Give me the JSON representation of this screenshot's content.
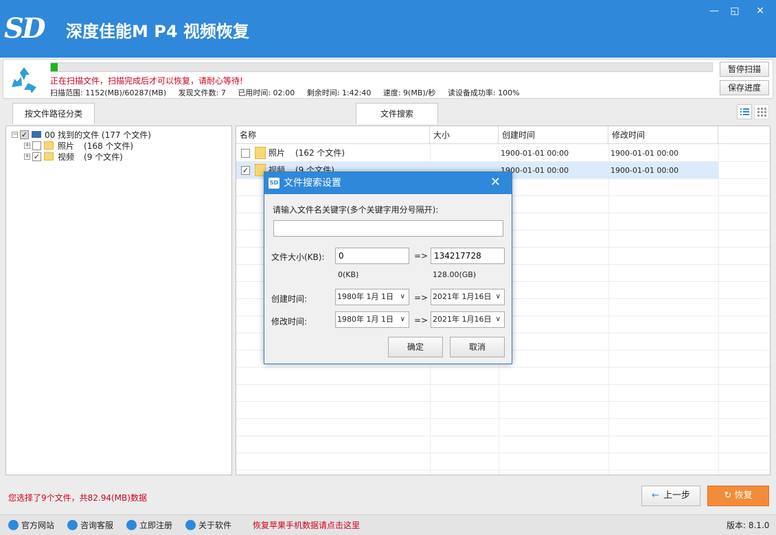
{
  "app": {
    "logo_text": "SD",
    "title": "深度佳能M P4 视频恢复"
  },
  "window_controls": {
    "minimize": "—",
    "restore": "◱",
    "close": "✕"
  },
  "scan": {
    "progress": 0.01,
    "warning": "正在扫描文件，扫描完成后才可以恢复，请耐心等待!",
    "range": "扫描范围: 1152(MB)/60287(MB)",
    "found": "发现文件数: 7",
    "elapsed": "已用时间: 02:00",
    "remaining": "剩余时间: 1:42:40",
    "speed": "速度: 9(MB)/秒",
    "read_rate": "读设备成功率: 100%",
    "pause_label": "暂停扫描",
    "save_label": "保存进度"
  },
  "tabs": {
    "by_path": "按文件路径分类",
    "search": "文件搜索"
  },
  "tree": {
    "root": "00 找到的文件 (177 个文件)",
    "items": [
      {
        "name": "照片",
        "count": "(168 个文件)",
        "checked": false
      },
      {
        "name": "视频",
        "count": "(9 个文件)",
        "checked": true
      }
    ]
  },
  "list": {
    "columns": [
      "名称",
      "大小",
      "创建时间",
      "修改时间"
    ],
    "rows": [
      {
        "name": "照片",
        "count": "(162 个文件)",
        "size": "",
        "created": "1900-01-01  00:00",
        "modified": "1900-01-01  00:00",
        "checked": false,
        "selected": false
      },
      {
        "name": "视频",
        "count": "(9 个文件)",
        "size": "",
        "created": "1900-01-01  00:00",
        "modified": "1900-01-01  00:00",
        "checked": true,
        "selected": true
      }
    ]
  },
  "dialog": {
    "icon_text": "SD",
    "title": "文件搜索设置",
    "close": "✕",
    "keyword_label": "请输入文件名关键字(多个关键字用分号隔开):",
    "keyword_value": "",
    "size_label": "文件大小(KB):",
    "size_min": "0",
    "size_max": "134217728",
    "size_min_hint": "0(KB)",
    "size_max_hint": "128.00(GB)",
    "arrow": "=>",
    "created_label": "创建时间:",
    "created_from": "1980年  1月  1日",
    "created_to": "2021年  1月16日",
    "modified_label": "修改时间:",
    "modified_from": "1980年  1月  1日",
    "modified_to": "2021年  1月16日",
    "ok_label": "确定",
    "cancel_label": "取消"
  },
  "status": {
    "selection": "您选择了9个文件，共82.94(MB)数据",
    "prev_label": "上一步",
    "recover_label": "恢复"
  },
  "footer": {
    "links": [
      "官方网站",
      "咨询客服",
      "立即注册",
      "关于软件"
    ],
    "promo": "恢复苹果手机数据请点击这里",
    "version": "版本: 8.1.0"
  },
  "colors": {
    "brand": "#2f88d9",
    "progress": "#1bb51b",
    "warning": "#d0021b",
    "recover": "#f28c3a"
  }
}
